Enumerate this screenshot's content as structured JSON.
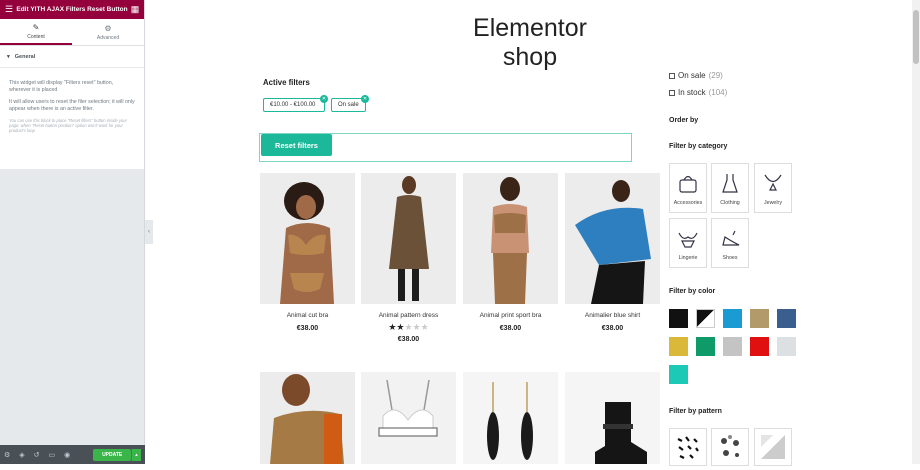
{
  "editor": {
    "title": "Edit YITH AJAX Filters Reset Button",
    "tabs": [
      "Content",
      "Advanced"
    ],
    "section": "General",
    "desc1": "This widget will display \"Filters reset\" button, wherever it is placed",
    "desc2": "It will allow users to reset the filer selection; it will only appear when there is an active filter.",
    "desc3": "You can use this block to place \"Reset filters\" button inside your page, when \"Reset button position\" option won't work for your product's loop",
    "update_label": "UPDATE"
  },
  "shop": {
    "title": "Elementor shop",
    "active_filters_label": "Active filters",
    "chips": [
      "€10.00 - €100.00",
      "On sale"
    ],
    "reset_label": "Reset filters"
  },
  "products": [
    {
      "name": "Animal cut bra",
      "price": "€38.00"
    },
    {
      "name": "Animal pattern dress",
      "price": "€38.00",
      "rating": 2,
      "rating_max": 5
    },
    {
      "name": "Animal print sport bra",
      "price": "€38.00"
    },
    {
      "name": "Animalier blue shirt",
      "price": "€38.00"
    }
  ],
  "sidebar": {
    "on_sale": {
      "label": "On sale",
      "count": "(29)"
    },
    "in_stock": {
      "label": "In stock",
      "count": "(104)"
    },
    "order_by": "Order by",
    "category_heading": "Filter by category",
    "categories": [
      "Accessories",
      "Clothing",
      "Jewelry",
      "Lingerie",
      "Shoes"
    ],
    "color_heading": "Filter by color",
    "colors": [
      "#111111",
      "#111111",
      "#1a9bd1",
      "#b39a6a",
      "#3a5f8f",
      "#d9b83a",
      "#0f9a6a",
      "#c4c4c4",
      "#e01010",
      "#dde0e3",
      "#1cc9b7"
    ],
    "pattern_heading": "Filter by pattern"
  }
}
